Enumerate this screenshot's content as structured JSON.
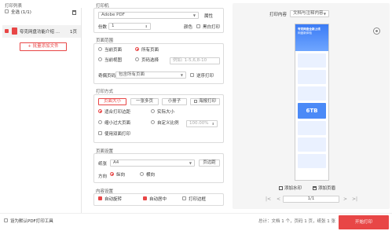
{
  "left": {
    "title": "打印列表",
    "select_all": "全选 (1/1)",
    "file_name": "夸克网盘功能介绍 ...",
    "file_pages": "1页",
    "add_files": "+ 批量添加文件",
    "set_default": "设为默认PDF打印工具"
  },
  "printer": {
    "title": "打印机",
    "name": "Adobe PDF",
    "properties": "属性",
    "copies_label": "份数",
    "copies_value": "1",
    "color_label": "颜色",
    "bw_label": "黑白打印"
  },
  "page_range": {
    "title": "页面范围",
    "current_page": "当前页面",
    "all_pages": "所有页面",
    "current_view": "当前视图",
    "page_select": "页码选择",
    "page_select_placeholder": "例如: 1-5,6,8-10",
    "odd_even_label": "奇偶页码",
    "odd_even_value": "包含所有页面",
    "reverse": "逆序打印"
  },
  "print_mode": {
    "title": "打印方式",
    "btn_page_size": "页面大小",
    "btn_multi": "一张多页",
    "btn_booklet": "小册子",
    "btn_poster": "海报打印",
    "fit_area": "适合打印边距",
    "actual_size": "实际大小",
    "shrink_oversize": "缩小过大页面",
    "custom_scale": "自定义比例",
    "scale_value": "100.00%",
    "duplex": "使用双面打印"
  },
  "page_setup": {
    "title": "页面设置",
    "paper_label": "纸张",
    "paper_value": "A4",
    "page_margin": "页边距",
    "orientation_label": "方向",
    "portrait": "纵向",
    "landscape": "横向"
  },
  "content_setup": {
    "title": "内容设置",
    "auto_rotate": "自动旋转",
    "auto_center": "自动居中",
    "print_annot": "打印边框"
  },
  "preview": {
    "content_label": "打印内容",
    "content_value": "文档与注释内容",
    "add_watermark": "添加水印",
    "add_header": "添加页眉",
    "page_indicator": "1/1",
    "summary": "文档 1 个，页码 1 页，纸张 1 张",
    "summary_prefix": "总计：",
    "start_print": "开始打印",
    "thumb_title": "夸克网盘全新上线",
    "thumb_sub": "网盘新体验",
    "thumb_storage": "6TB"
  },
  "colors": {
    "accent": "#e84646"
  }
}
